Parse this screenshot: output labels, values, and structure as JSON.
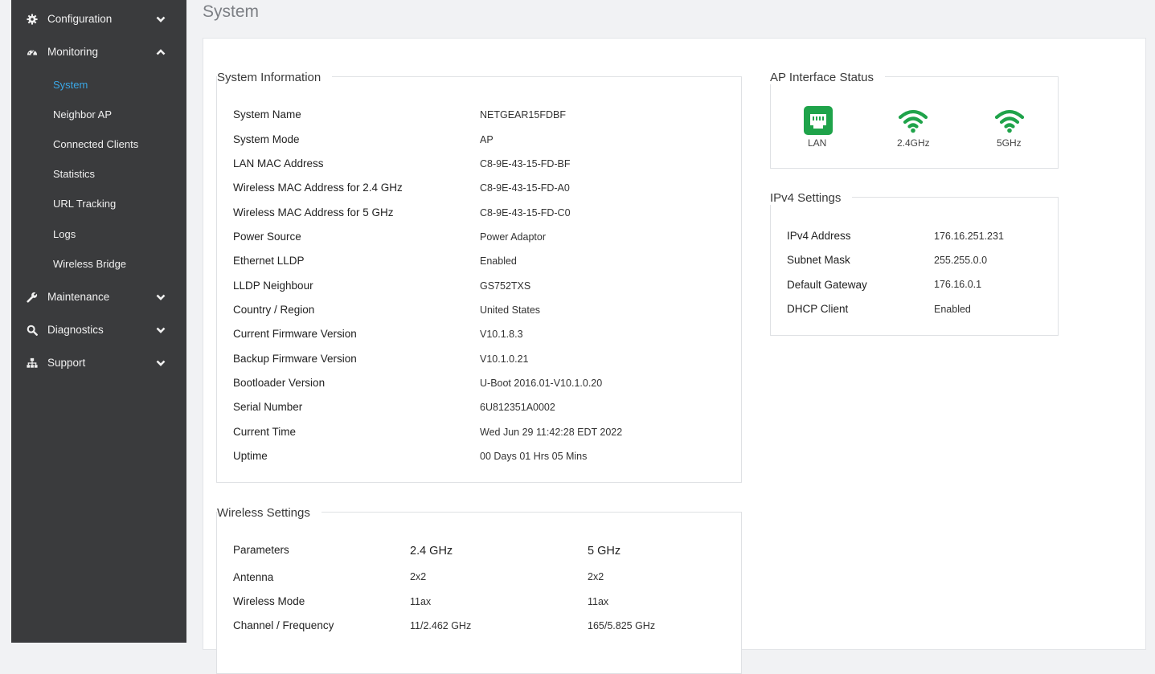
{
  "sidebar": {
    "items": [
      {
        "label": "Configuration",
        "icon": "gear-icon",
        "expanded": false
      },
      {
        "label": "Monitoring",
        "icon": "dashboard-icon",
        "expanded": true
      },
      {
        "label": "Maintenance",
        "icon": "wrench-icon",
        "expanded": false
      },
      {
        "label": "Diagnostics",
        "icon": "search-icon",
        "expanded": false
      },
      {
        "label": "Support",
        "icon": "sitemap-icon",
        "expanded": false
      }
    ],
    "monitoring_subitems": [
      {
        "label": "System",
        "active": true
      },
      {
        "label": "Neighbor AP",
        "active": false
      },
      {
        "label": "Connected Clients",
        "active": false
      },
      {
        "label": "Statistics",
        "active": false
      },
      {
        "label": "URL Tracking",
        "active": false
      },
      {
        "label": "Logs",
        "active": false
      },
      {
        "label": "Wireless Bridge",
        "active": false
      }
    ],
    "active_color": "#3aa7e6"
  },
  "page": {
    "title": "System"
  },
  "system_information": {
    "title": "System Information",
    "rows": [
      {
        "label": "System Name",
        "value": "NETGEAR15FDBF"
      },
      {
        "label": "System Mode",
        "value": "AP"
      },
      {
        "label": "LAN MAC Address",
        "value": "C8-9E-43-15-FD-BF"
      },
      {
        "label": "Wireless MAC Address for 2.4 GHz",
        "value": "C8-9E-43-15-FD-A0"
      },
      {
        "label": "Wireless MAC Address for 5 GHz",
        "value": "C8-9E-43-15-FD-C0"
      },
      {
        "label": "Power Source",
        "value": "Power Adaptor"
      },
      {
        "label": "Ethernet LLDP",
        "value": "Enabled"
      },
      {
        "label": "LLDP Neighbour",
        "value": "GS752TXS"
      },
      {
        "label": "Country / Region",
        "value": "United States"
      },
      {
        "label": "Current Firmware Version",
        "value": "V10.1.8.3"
      },
      {
        "label": "Backup Firmware Version",
        "value": "V10.1.0.21"
      },
      {
        "label": "Bootloader Version",
        "value": "U-Boot 2016.01-V10.1.0.20"
      },
      {
        "label": "Serial Number",
        "value": "6U812351A0002"
      },
      {
        "label": "Current Time",
        "value": "Wed Jun 29 11:42:28 EDT 2022"
      },
      {
        "label": "Uptime",
        "value": "00 Days 01 Hrs 05 Mins"
      }
    ]
  },
  "wireless_settings": {
    "title": "Wireless Settings",
    "headers": [
      "Parameters",
      "2.4 GHz",
      "5 GHz"
    ],
    "rows": [
      {
        "label": "Antenna",
        "v24": "2x2",
        "v5": "2x2"
      },
      {
        "label": "Wireless Mode",
        "v24": "11ax",
        "v5": "11ax"
      },
      {
        "label": "Channel / Frequency",
        "v24": "11/2.462 GHz",
        "v5": "165/5.825 GHz"
      }
    ]
  },
  "ap_interface_status": {
    "title": "AP Interface Status",
    "interfaces": [
      {
        "label": "LAN",
        "icon": "ethernet-port-icon"
      },
      {
        "label": "2.4GHz",
        "icon": "wifi-icon"
      },
      {
        "label": "5GHz",
        "icon": "wifi-icon"
      }
    ],
    "status_color": "#1fa34a"
  },
  "ipv4_settings": {
    "title": "IPv4 Settings",
    "rows": [
      {
        "label": "IPv4 Address",
        "value": "176.16.251.231"
      },
      {
        "label": "Subnet Mask",
        "value": "255.255.0.0"
      },
      {
        "label": "Default Gateway",
        "value": "176.16.0.1"
      },
      {
        "label": "DHCP Client",
        "value": "Enabled"
      }
    ]
  }
}
